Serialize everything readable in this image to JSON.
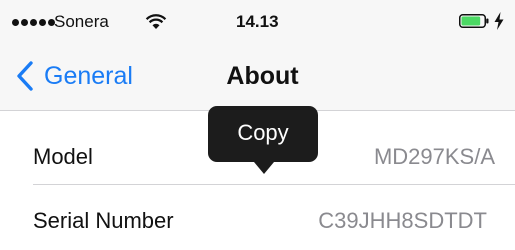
{
  "status_bar": {
    "carrier": "Sonera",
    "time": "14.13",
    "signal_bars_filled": 5,
    "battery_level": 0.85,
    "battery_color": "#4cd964",
    "icons": [
      "signal-dots-icon",
      "wifi-icon",
      "battery-icon",
      "charging-bolt-icon"
    ]
  },
  "nav": {
    "back_label": "General",
    "title": "About",
    "accent_color": "#1a7cf5"
  },
  "rows": [
    {
      "label": "Model",
      "value": "MD297KS/A"
    },
    {
      "label": "Serial Number",
      "value": "C39JHH8SDTDT"
    }
  ],
  "tooltip": {
    "label": "Copy"
  }
}
